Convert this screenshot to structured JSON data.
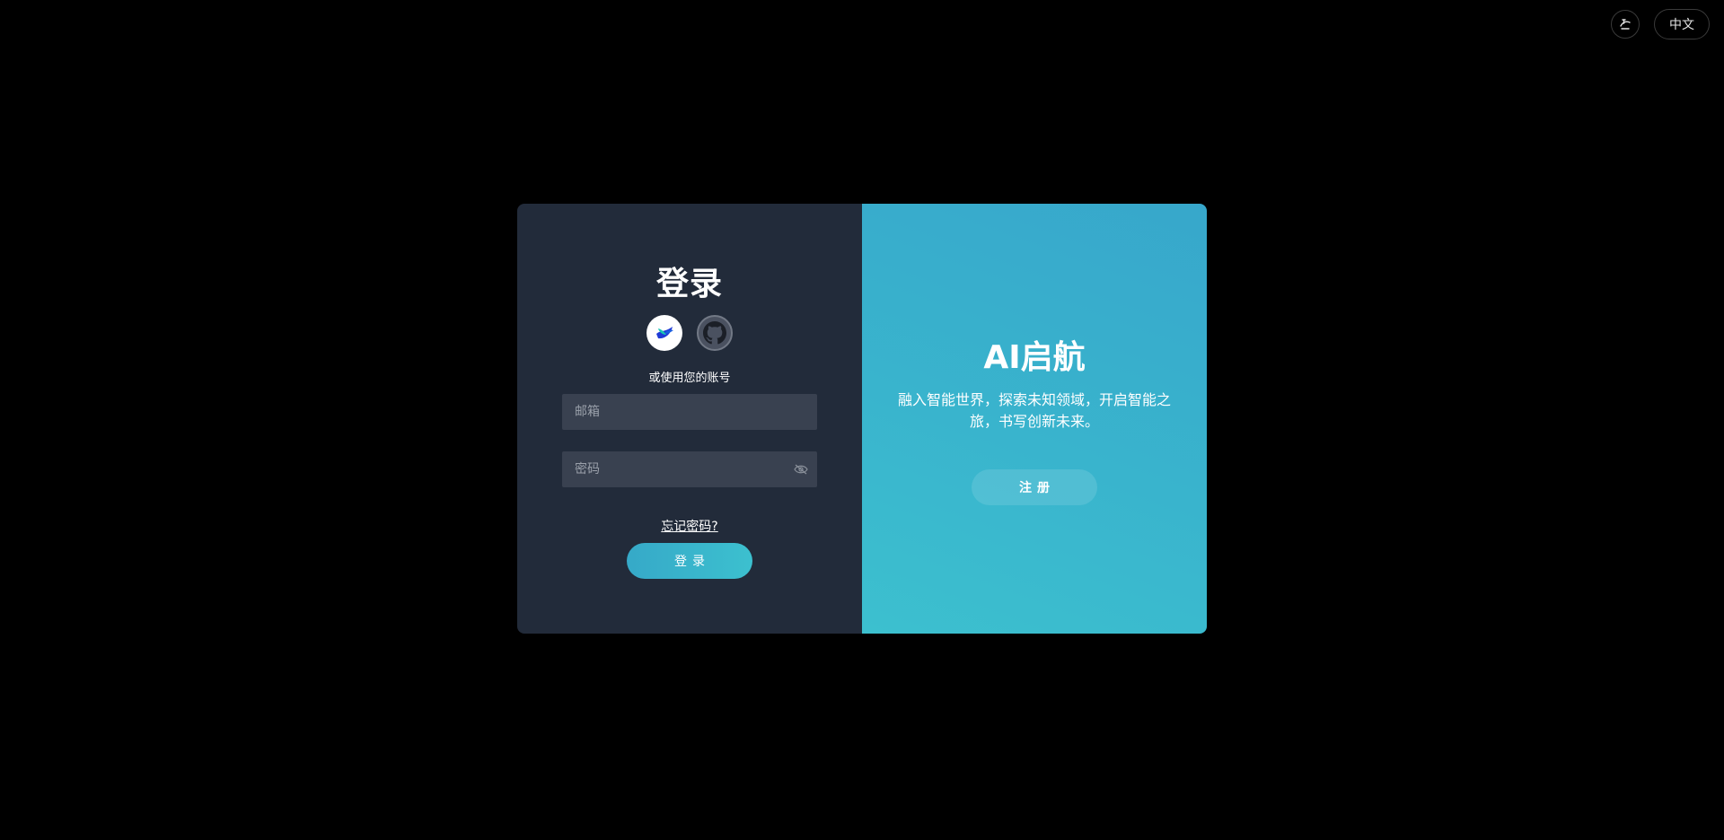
{
  "topbar": {
    "theme_icon": "theme-toggle-icon",
    "language_label": "中文"
  },
  "login": {
    "title": "登录",
    "social": [
      {
        "name": "feishu",
        "icon": "feishu-logo-icon"
      },
      {
        "name": "github",
        "icon": "github-logo-icon"
      }
    ],
    "or_text": "或使用您的账号",
    "email_placeholder": "邮箱",
    "password_placeholder": "密码",
    "password_toggle_icon": "eye-hidden-icon",
    "forgot_label": "忘记密码?",
    "submit_label": "登录"
  },
  "promo": {
    "title": "AI启航",
    "description": "融入智能世界，探索未知领域，开启智能之旅，书写创新未来。",
    "register_label": "注册"
  },
  "colors": {
    "background": "#000000",
    "left_panel": "#222b3a",
    "input_bg": "#394150",
    "accent_start": "#37a7cb",
    "accent_end": "#3cc0cf"
  }
}
